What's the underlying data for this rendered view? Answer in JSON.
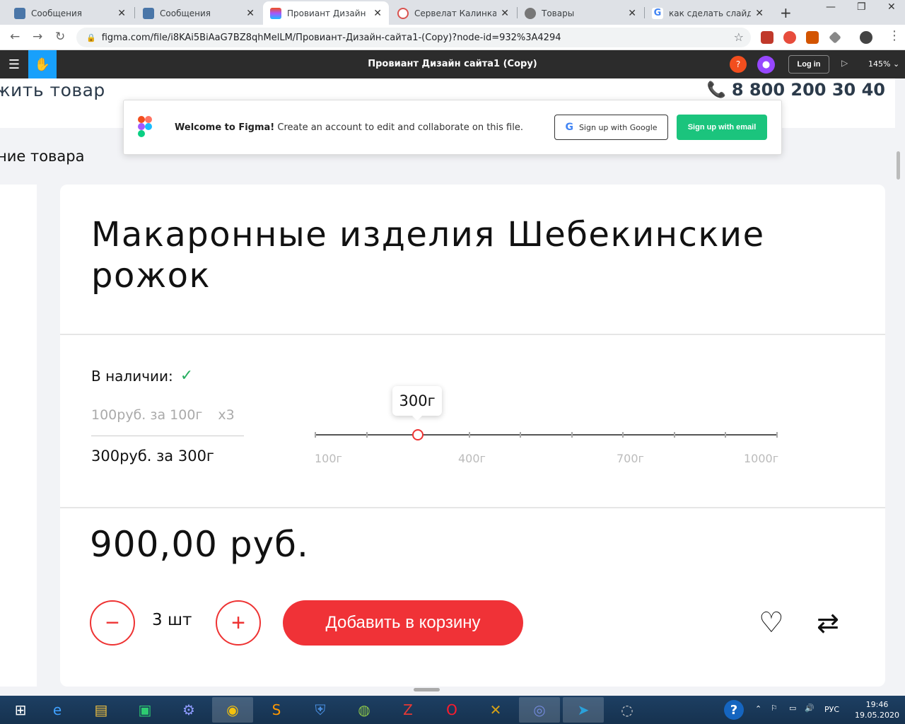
{
  "browser": {
    "tabs": [
      {
        "title": "Сообщения",
        "favicon": "vk-messages-icon",
        "color": "#4a76a8"
      },
      {
        "title": "Сообщения",
        "favicon": "vk-messages-icon",
        "color": "#4a76a8"
      },
      {
        "title": "Провиант Дизайн са",
        "favicon": "figma-icon",
        "color": "#f24e1e",
        "active": true
      },
      {
        "title": "Сервелат Калинка ф",
        "favicon": "shop-icon",
        "color": "#d9534f"
      },
      {
        "title": "Товары",
        "favicon": "globe-icon",
        "color": "#777"
      },
      {
        "title": "как сделать слайдер",
        "favicon": "google-icon",
        "color": "#4285f4"
      }
    ],
    "url": "figma.com/file/i8KAi5BiAaG7BZ8qhMelLM/Провиант-Дизайн-сайта1-(Copy)?node-id=932%3A4294"
  },
  "figma": {
    "file_title": "Провиант Дизайн сайта1 (Copy)",
    "help_label": "?",
    "login_label": "Log in",
    "zoom": "145% ⌄",
    "accent": "#18a0fb"
  },
  "toast": {
    "welcome_bold": "Welcome to Figma!",
    "welcome_text": " Create an account to edit and collaborate on this file.",
    "google_label": "Sign up with Google",
    "email_label": "Sign up with email"
  },
  "site": {
    "add_product": "жить товар",
    "phone": "8 800 200 30 40",
    "description_label": "ние товара",
    "product_title": "Макаронные изделия Шебекинские рожок",
    "in_stock_label": "В наличии:",
    "option1_price": "100руб. за 100г",
    "option1_mult": "x3",
    "option2": "300руб. за 300г",
    "slider": {
      "value_label": "300г",
      "labels": [
        "100г",
        "400г",
        "700г",
        "1000г"
      ],
      "selected_index": 2,
      "tick_count": 10
    },
    "price": "900,00 руб.",
    "minus": "−",
    "plus": "+",
    "quantity": "3 шт",
    "add_to_cart": "Добавить в корзину",
    "accent_red": "#f03237"
  },
  "taskbar": {
    "lang": "РУС",
    "time": "19:46",
    "date": "19.05.2020"
  }
}
